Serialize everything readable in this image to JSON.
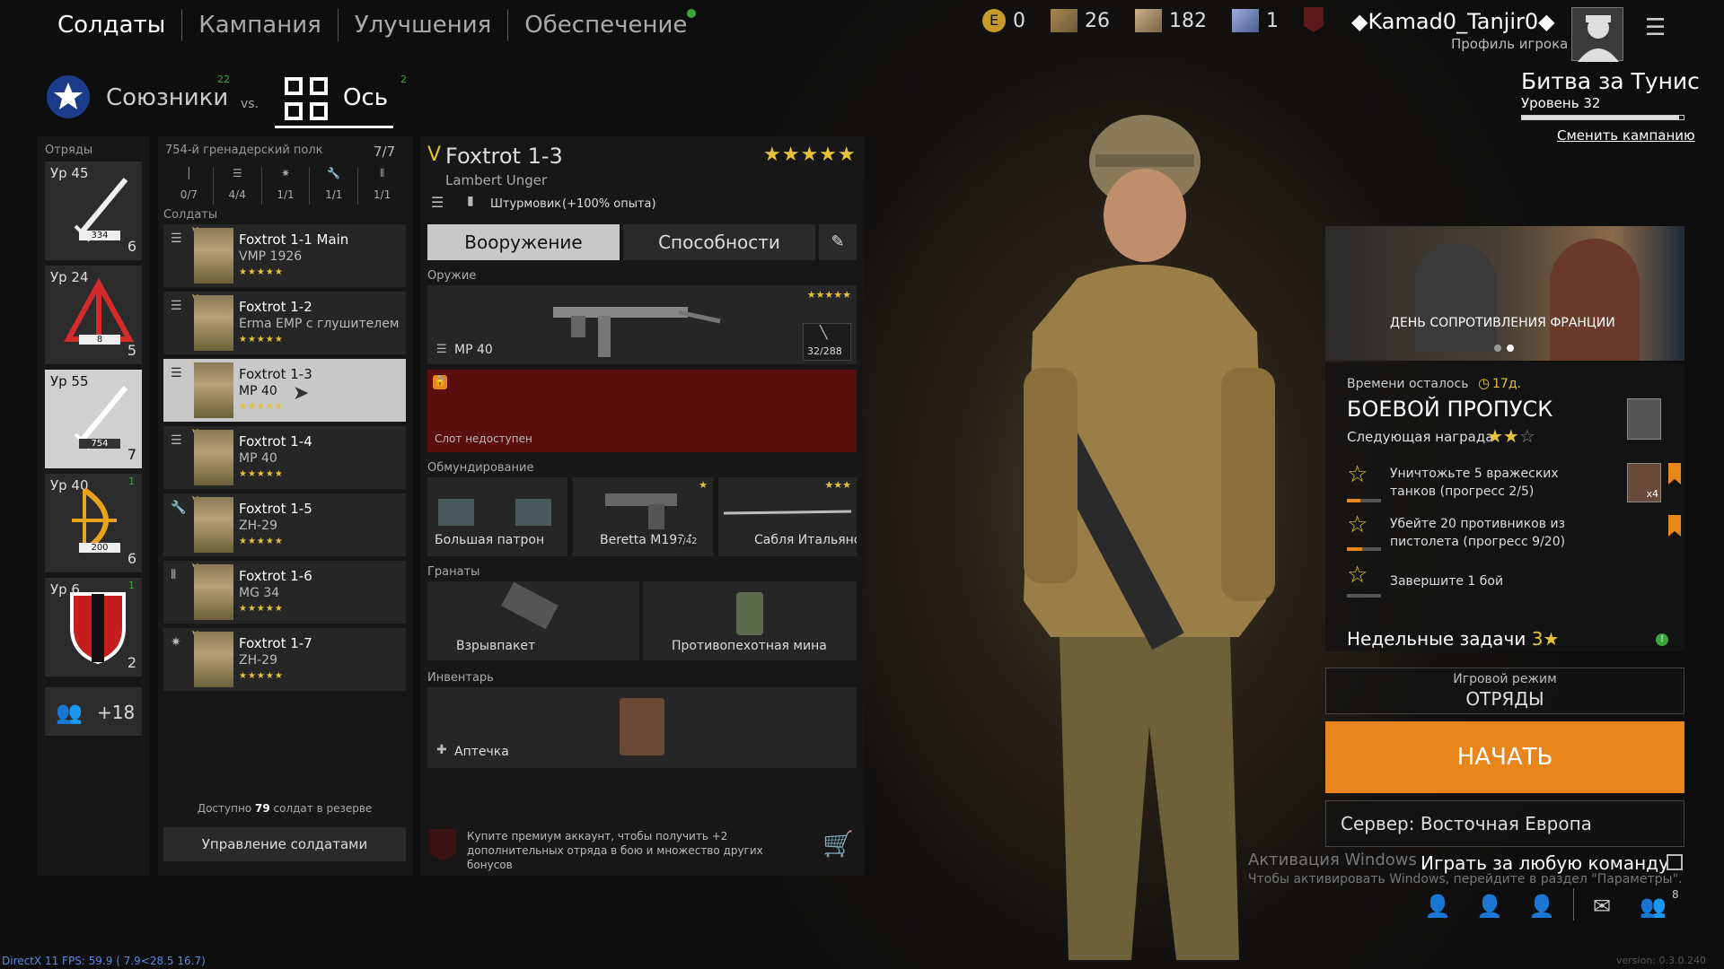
{
  "nav": {
    "tabs": [
      "Солдаты",
      "Кампания",
      "Улучшения",
      "Обеспечение"
    ]
  },
  "currency": {
    "e": "0",
    "tickets": "26",
    "gold": "182",
    "orders": "1"
  },
  "player": {
    "name": "◆Kamad0_Tanjir0◆",
    "profile": "Профиль игрока"
  },
  "sides": {
    "allies": "Союзники",
    "allies_count": "22",
    "vs": "vs.",
    "axis": "Ось",
    "axis_count": "2"
  },
  "campaign": {
    "title": "Битва за Тунис",
    "level": "Уровень 32",
    "level_fraction": 0.97,
    "change": "Сменить кампанию"
  },
  "squads": {
    "header": "Отряды",
    "items": [
      {
        "lv": "Ур 45",
        "tag": "334",
        "count": "6"
      },
      {
        "lv": "Ур 24",
        "tag": "8",
        "count": "5"
      },
      {
        "lv": "Ур 55",
        "tag": "754",
        "count": "7"
      },
      {
        "lv": "Ур 40",
        "tag": "200",
        "count": "6",
        "badge": "1"
      },
      {
        "lv": "Ур 6",
        "tag": "",
        "count": "2",
        "badge": "1"
      }
    ],
    "more": "+18"
  },
  "regiment": {
    "title": "754-й гренадерский полк",
    "count": "7/7",
    "stats": [
      "0/7",
      "4/4",
      "1/1",
      "1/1",
      "1/1"
    ],
    "soldiers_label": "Солдаты",
    "soldiers": [
      {
        "name": "Foxtrot 1-1 Main",
        "weapon": "VMP 1926",
        "stars": "★★★★★"
      },
      {
        "name": "Foxtrot 1-2",
        "weapon": "Erma EMP с глушителем",
        "stars": "★★★★★"
      },
      {
        "name": "Foxtrot 1-3",
        "weapon": "MP 40",
        "stars": "★★★★★"
      },
      {
        "name": "Foxtrot 1-4",
        "weapon": "MP 40",
        "stars": "★★★★★"
      },
      {
        "name": "Foxtrot 1-5",
        "weapon": "ZH-29",
        "stars": "★★★★★"
      },
      {
        "name": "Foxtrot 1-6",
        "weapon": "MG 34",
        "stars": "★★★★★"
      },
      {
        "name": "Foxtrot 1-7",
        "weapon": "ZH-29",
        "stars": "★★★★★"
      }
    ],
    "reserve_pre": "Доступно",
    "reserve_num": "79",
    "reserve_post": "солдат в резерве",
    "manage": "Управление солдатами"
  },
  "detail": {
    "rank": "V",
    "name": "Foxtrot 1-3",
    "sub": "Lambert Unger",
    "class": "Штурмовик",
    "exp": "(+100% опыта)",
    "stars": "★★★★★",
    "tabs": [
      "Вооружение",
      "Способности"
    ],
    "weapons_label": "Оружие",
    "weapon_name": "MP 40",
    "ammo": "32/288",
    "weapon_stars": "★★★★★",
    "locked": "Слот недоступен",
    "equip_label": "Обмундирование",
    "equip": [
      "Большая патрон",
      "Beretta M1934",
      "Сабля Итальянская"
    ],
    "equip_stars": [
      "★",
      "★★★"
    ],
    "beretta_ammo": "7/42",
    "grenades_label": "Гранаты",
    "grenades": [
      "Взрывпакет",
      "Противопехотная мина"
    ],
    "inv_label": "Инвентарь",
    "inv": "Аптечка",
    "premium": "Купите премиум аккаунт, чтобы получить +2 дополнительных отряда в бою и множество других бонусов"
  },
  "event": {
    "title": "ДЕНЬ СОПРОТИВЛЕНИЯ ФРАНЦИИ"
  },
  "battlepass": {
    "time_label": "Времени осталось",
    "time": "17д.",
    "title": "БОЕВОЙ ПРОПУСК",
    "next": "Следующая награда",
    "tasks": [
      {
        "text": "Уничтожьте 5 вражеских танков (прогресс 2/5)",
        "progress": 0.4
      },
      {
        "text": "Убейте 20 противников из пистолета (прогресс 9/20)",
        "progress": 0.45
      },
      {
        "text": "Завершите 1 бой",
        "progress": 0
      }
    ],
    "reward_mult": "x4",
    "weekly": "Недельные задачи",
    "weekly_count": "3"
  },
  "mode": {
    "label": "Игровой режим",
    "value": "ОТРЯДЫ"
  },
  "start": "НАЧАТЬ",
  "server": "Сервер: Восточная Европа",
  "anyteam": "Играть за любую команду",
  "windows": {
    "l1": "Активация Windows",
    "l2": "Чтобы активировать Windows, перейдите в раздел \"Параметры\"."
  },
  "friends_count": "8",
  "fps": "DirectX 11 FPS: 59.9 ( 7.9<28.5 16.7)",
  "version": "version: 0.3.0.240",
  "colors": {
    "accent": "#e8861c",
    "gold": "#e6c23a",
    "locked": "#5a0e0e",
    "green": "#3aa53a"
  }
}
